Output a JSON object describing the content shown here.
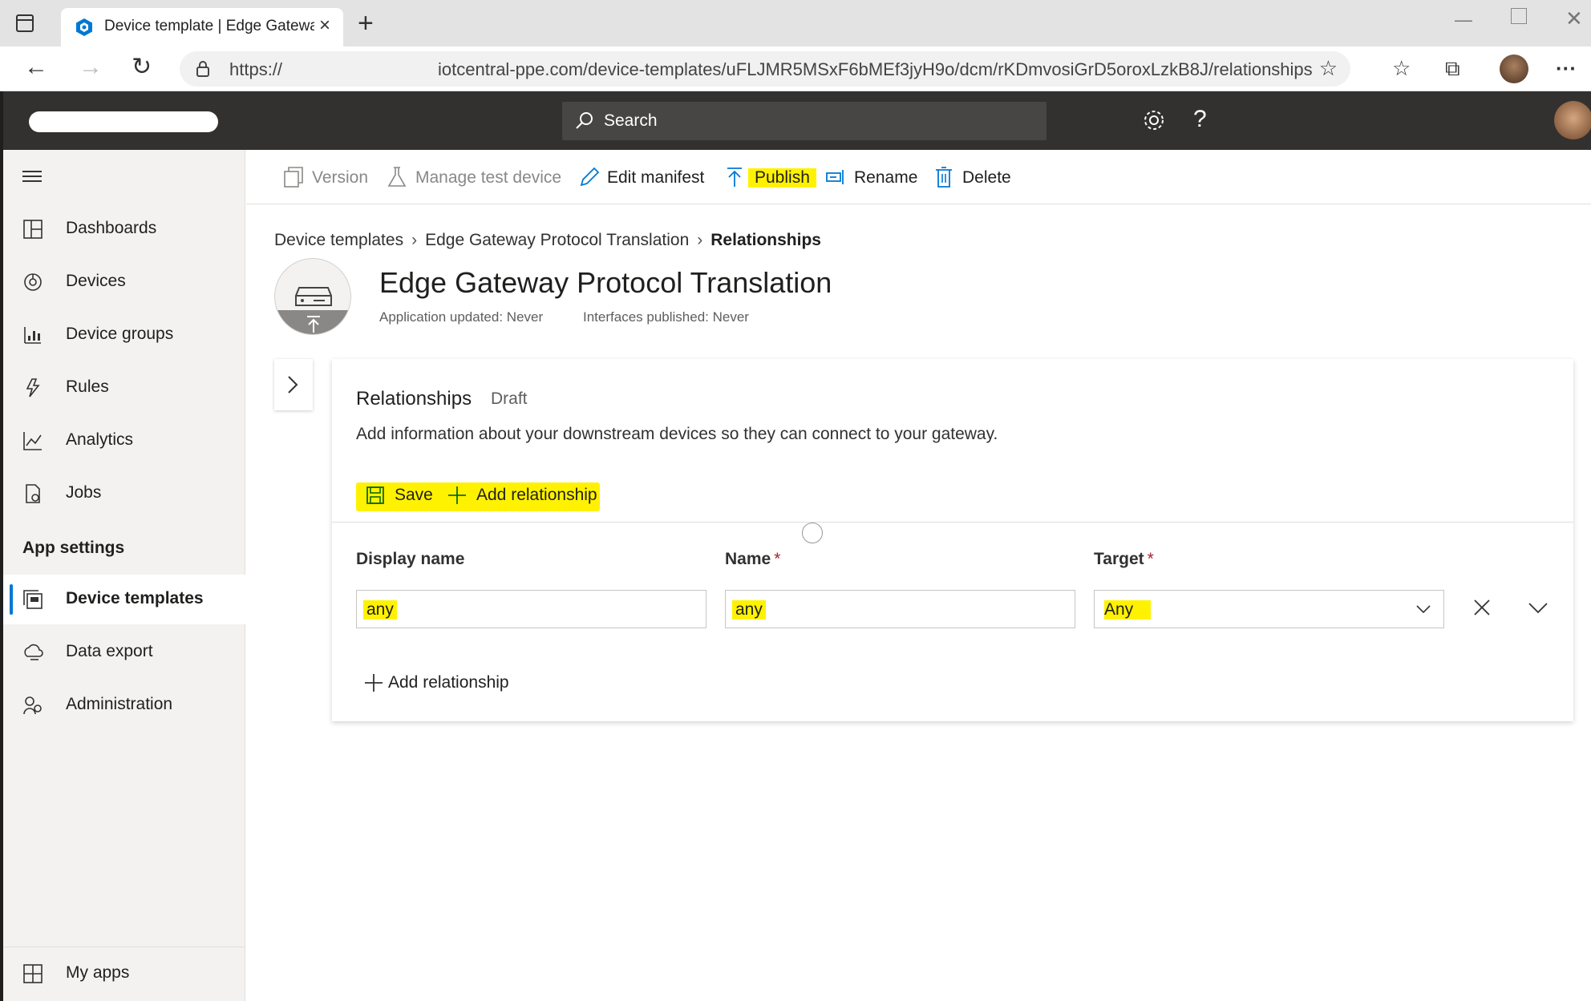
{
  "browser": {
    "tab_title": "Device template | Edge Gateway",
    "url_prefix": "https://",
    "url_suffix": "iotcentral-ppe.com/device-templates/uFLJMR5MSxF6bMEf3jyH9o/dcm/rKDmvosiGrD5oroxLzkB8J/relationships"
  },
  "header": {
    "search_placeholder": "Search"
  },
  "sidebar": {
    "items": [
      {
        "label": "Dashboards"
      },
      {
        "label": "Devices"
      },
      {
        "label": "Device groups"
      },
      {
        "label": "Rules"
      },
      {
        "label": "Analytics"
      },
      {
        "label": "Jobs"
      }
    ],
    "section_label": "App settings",
    "settings_items": [
      {
        "label": "Device templates",
        "active": true
      },
      {
        "label": "Data export"
      },
      {
        "label": "Administration"
      }
    ],
    "footer_item": {
      "label": "My apps"
    }
  },
  "toolbar": {
    "version": "Version",
    "manage_test_device": "Manage test device",
    "edit_manifest": "Edit manifest",
    "publish": "Publish",
    "rename": "Rename",
    "delete": "Delete"
  },
  "breadcrumb": {
    "items": [
      "Device templates",
      "Edge Gateway Protocol Translation",
      "Relationships"
    ]
  },
  "template": {
    "title": "Edge Gateway Protocol Translation",
    "app_updated": "Application updated: Never",
    "interfaces_published": "Interfaces published: Never"
  },
  "relationships": {
    "title": "Relationships",
    "status": "Draft",
    "description": "Add information about your downstream devices so they can connect to your gateway.",
    "save_label": "Save",
    "add_label": "Add relationship",
    "columns": {
      "display_name": "Display name",
      "name": "Name",
      "target": "Target",
      "required_marker": "*"
    },
    "rows": [
      {
        "display_name": "any",
        "name": "any",
        "target": "Any"
      }
    ],
    "add_bottom_label": "Add relationship"
  },
  "colors": {
    "highlight": "#fff200",
    "header_bg": "#323130",
    "accent": "#0078d4"
  }
}
